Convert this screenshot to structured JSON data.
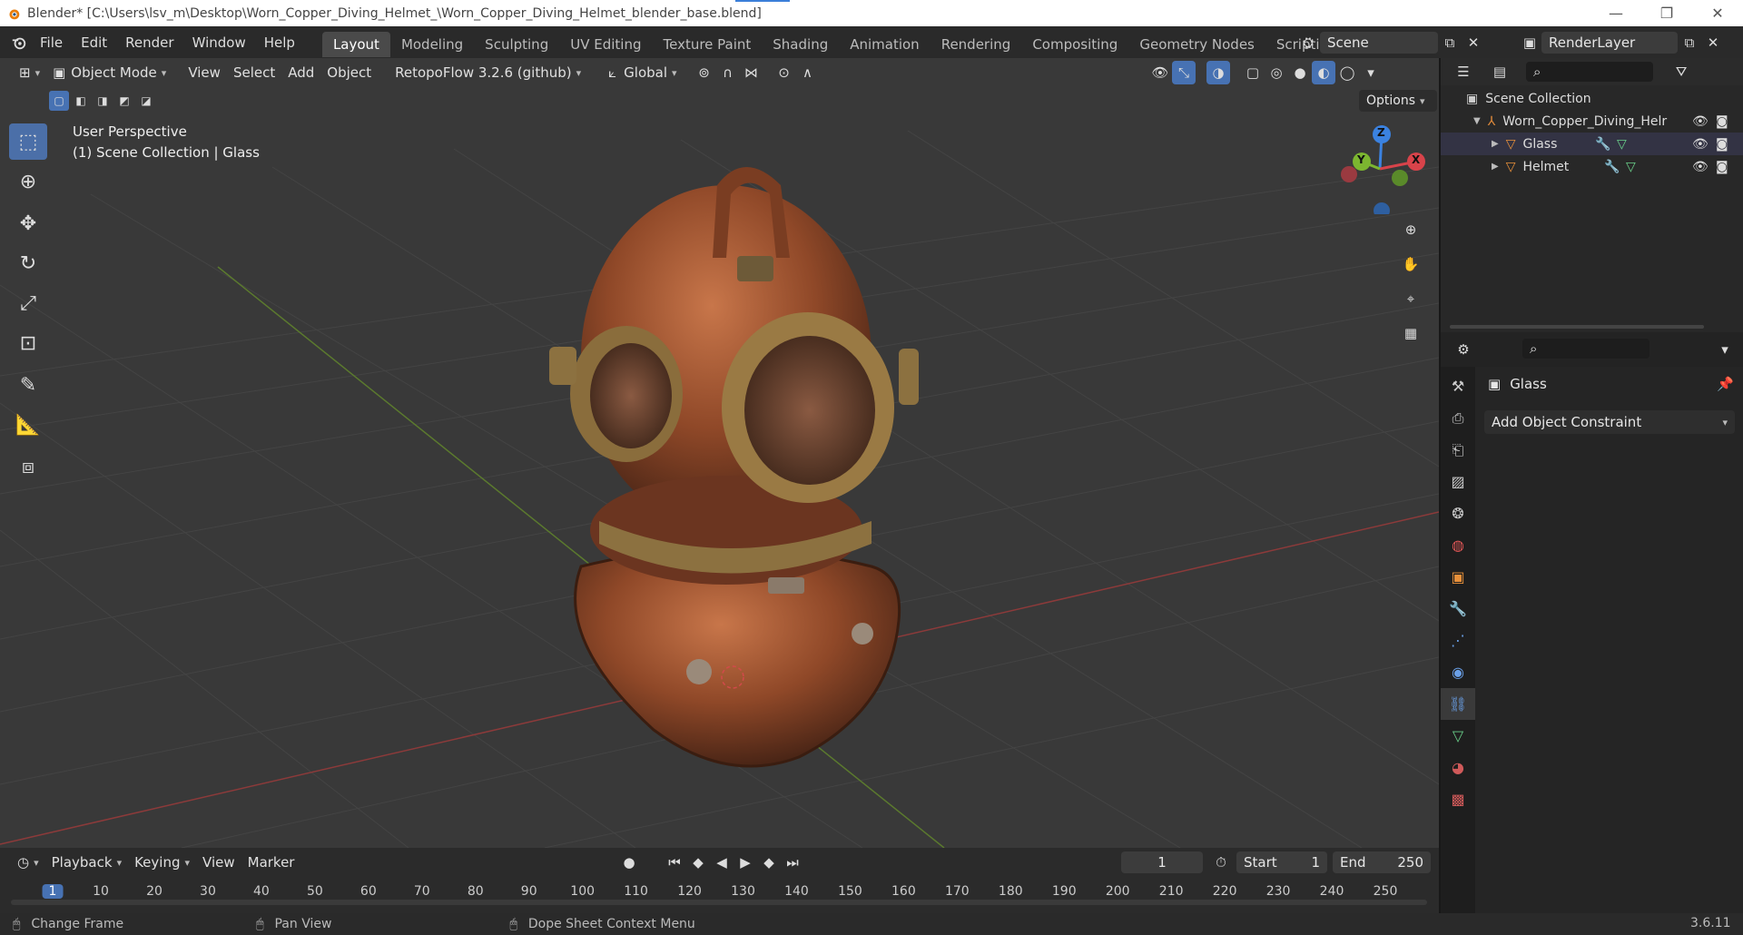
{
  "window": {
    "title": "Blender* [C:\\Users\\lsv_m\\Desktop\\Worn_Copper_Diving_Helmet_\\Worn_Copper_Diving_Helmet_blender_base.blend]",
    "min": "—",
    "max": "❐",
    "close": "✕"
  },
  "menu": [
    "File",
    "Edit",
    "Render",
    "Window",
    "Help"
  ],
  "workspaces": [
    "Layout",
    "Modeling",
    "Sculpting",
    "UV Editing",
    "Texture Paint",
    "Shading",
    "Animation",
    "Rendering",
    "Compositing",
    "Geometry Nodes",
    "Scripting"
  ],
  "active_workspace": 0,
  "scene": {
    "label": "Scene",
    "render_layer": "RenderLayer"
  },
  "viewport_header": {
    "mode": "Object Mode",
    "menus": [
      "View",
      "Select",
      "Add",
      "Object"
    ],
    "addon": "RetopoFlow 3.2.6 (github)",
    "transform": "Global",
    "options": "Options"
  },
  "viewport": {
    "line1": "User Perspective",
    "line2": "(1) Scene Collection | Glass",
    "gizmo": {
      "z": "Z",
      "y": "Y",
      "x": "X"
    }
  },
  "outliner": {
    "root": "Scene Collection",
    "items": [
      {
        "name": "Worn_Copper_Diving_Helr",
        "indent": 1
      },
      {
        "name": "Glass",
        "indent": 2
      },
      {
        "name": "Helmet",
        "indent": 2
      }
    ]
  },
  "properties": {
    "object_name": "Glass",
    "add_constraint": "Add Object Constraint"
  },
  "timeline": {
    "menus": [
      "Playback",
      "Keying",
      "View",
      "Marker"
    ],
    "current_frame": "1",
    "start_label": "Start",
    "start": "1",
    "end_label": "End",
    "end": "250",
    "ticks": [
      "1",
      "10",
      "20",
      "30",
      "40",
      "50",
      "60",
      "70",
      "80",
      "90",
      "100",
      "110",
      "120",
      "130",
      "140",
      "150",
      "160",
      "170",
      "180",
      "190",
      "200",
      "210",
      "220",
      "230",
      "240",
      "250"
    ]
  },
  "status": {
    "left": "Change Frame",
    "middle": "Pan View",
    "right": "Dope Sheet Context Menu",
    "version": "3.6.11"
  },
  "colors": {
    "accent": "#4772b3",
    "copper": "#b0603a",
    "brass": "#a98a4e"
  }
}
